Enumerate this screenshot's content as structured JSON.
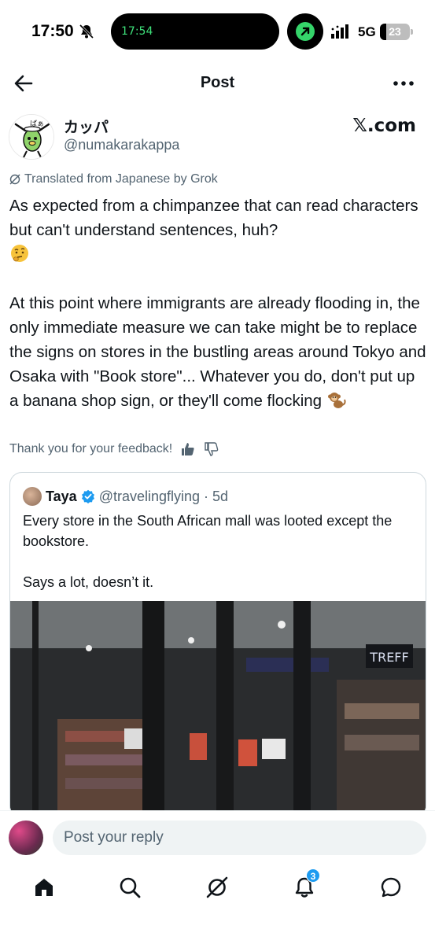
{
  "status_bar": {
    "time": "17:50",
    "island_time": "17:54",
    "network": "5G",
    "battery": "23"
  },
  "header": {
    "title": "Post"
  },
  "post": {
    "author_name": "カッパ",
    "author_handle": "@numakarakappa",
    "source": "𝕏.com",
    "translated_label": "Translated from Japanese by Grok",
    "paragraph1": "As expected from a chimpanzee that can read characters but can't understand sentences, huh?",
    "paragraph2": "At this point where immigrants are already flooding in, the only immediate measure we can take might be to replace the signs on stores in the bustling areas around Tokyo and Osaka with \"Book store\"... Whatever you do, don't put up a banana shop sign, or they'll come flocking",
    "feedback_label": "Thank you for your feedback!"
  },
  "quote": {
    "name": "Taya",
    "handle": "@travelingflying",
    "dot": "·",
    "age": "5d",
    "text": "Every store in the South African mall was looted except the bookstore.\n\nSays a lot, doesn’t it.",
    "media_sign": "TREFF"
  },
  "reply": {
    "placeholder": "Post your reply"
  },
  "tabs": {
    "notifications_badge": "3"
  },
  "colors": {
    "accent": "#1d9bf0",
    "secondary_text": "#536471",
    "island_green": "#35d46a"
  }
}
